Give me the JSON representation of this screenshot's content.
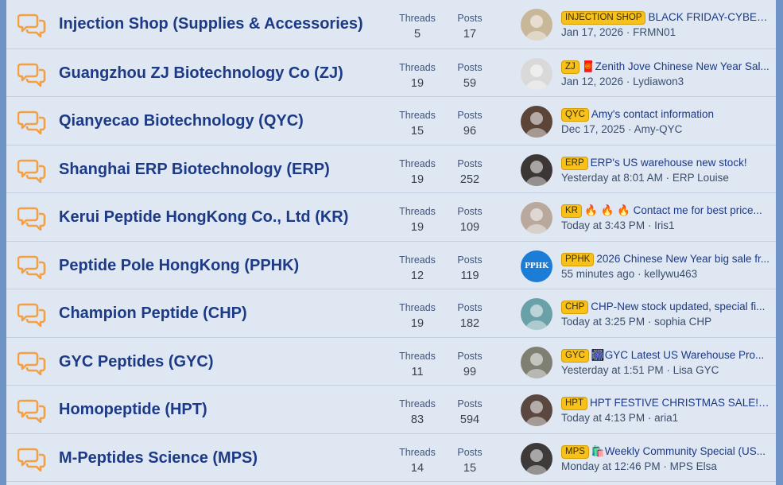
{
  "forums": [
    {
      "title": "Injection Shop (Supplies & Accessories)",
      "threads_label": "Threads",
      "threads": "5",
      "posts_label": "Posts",
      "posts": "17",
      "prefix": "INJECTION SHOP",
      "latest_title": "BLACK FRIDAY-CYBER M...",
      "date": "Jan 17, 2026",
      "author": "FRMN01",
      "avatar_color": "#c9b79a"
    },
    {
      "title": "Guangzhou ZJ Biotechnology Co (ZJ)",
      "threads_label": "Threads",
      "threads": "19",
      "posts_label": "Posts",
      "posts": "59",
      "prefix": "ZJ",
      "latest_title": "🧧Zenith Jove Chinese New Year Sal...",
      "date": "Jan 12, 2026",
      "author": "Lydiawon3",
      "avatar_color": "#d9d9d9"
    },
    {
      "title": "Qianyecao Biotechnology (QYC)",
      "threads_label": "Threads",
      "threads": "15",
      "posts_label": "Posts",
      "posts": "96",
      "prefix": "QYC",
      "latest_title": "Amy's contact information",
      "date": "Dec 17, 2025",
      "author": "Amy-QYC",
      "avatar_color": "#5b4438"
    },
    {
      "title": "Shanghai ERP Biotechnology (ERP)",
      "threads_label": "Threads",
      "threads": "19",
      "posts_label": "Posts",
      "posts": "252",
      "prefix": "ERP",
      "latest_title": "ERP's US warehouse new stock!",
      "date": "Yesterday at 8:01 AM",
      "author": "ERP Louise",
      "avatar_color": "#3c3634"
    },
    {
      "title": "Kerui Peptide HongKong Co., Ltd (KR)",
      "threads_label": "Threads",
      "threads": "19",
      "posts_label": "Posts",
      "posts": "109",
      "prefix": "KR",
      "latest_title": "🔥 🔥 🔥 Contact me for best price...",
      "date": "Today at 3:43 PM",
      "author": "Iris1",
      "avatar_color": "#b9a89c"
    },
    {
      "title": "Peptide Pole HongKong (PPHK)",
      "threads_label": "Threads",
      "threads": "12",
      "posts_label": "Posts",
      "posts": "119",
      "prefix": "PPHK",
      "latest_title": "2026 Chinese New Year big sale fr...",
      "date": "55 minutes ago",
      "author": "kellywu463",
      "avatar_color": "#1c7dd6",
      "avatar_text": "PPHK"
    },
    {
      "title": "Champion Peptide (CHP)",
      "threads_label": "Threads",
      "threads": "19",
      "posts_label": "Posts",
      "posts": "182",
      "prefix": "CHP",
      "latest_title": "CHP-New stock updated, special fi...",
      "date": "Today at 3:25 PM",
      "author": "sophia CHP",
      "avatar_color": "#6aa0a8"
    },
    {
      "title": "GYC Peptides (GYC)",
      "threads_label": "Threads",
      "threads": "11",
      "posts_label": "Posts",
      "posts": "99",
      "prefix": "GYC",
      "latest_title": "🎆GYC Latest US Warehouse Pro...",
      "date": "Yesterday at 1:51 PM",
      "author": "Lisa GYC",
      "avatar_color": "#7f7f73"
    },
    {
      "title": "Homopeptide (HPT)",
      "threads_label": "Threads",
      "threads": "83",
      "posts_label": "Posts",
      "posts": "594",
      "prefix": "HPT",
      "latest_title": "HPT FESTIVE CHRISTMAS SALE! ...",
      "date": "Today at 4:13 PM",
      "author": "aria1",
      "avatar_color": "#5a4840"
    },
    {
      "title": "M-Peptides Science (MPS)",
      "threads_label": "Threads",
      "threads": "14",
      "posts_label": "Posts",
      "posts": "15",
      "prefix": "MPS",
      "latest_title": "🛍️Weekly Community Special (US...",
      "date": "Monday at 12:46 PM",
      "author": "MPS Elsa",
      "avatar_color": "#3e3a3a"
    }
  ],
  "separator": " · ",
  "colors": {
    "title": "#1c3a86",
    "badge": "#f8c11a",
    "icon": "#f2a043",
    "frame": "#6e93c5",
    "row_bg": "#dfe7f2"
  },
  "icon_name": "forum-chat-bubbles-icon"
}
